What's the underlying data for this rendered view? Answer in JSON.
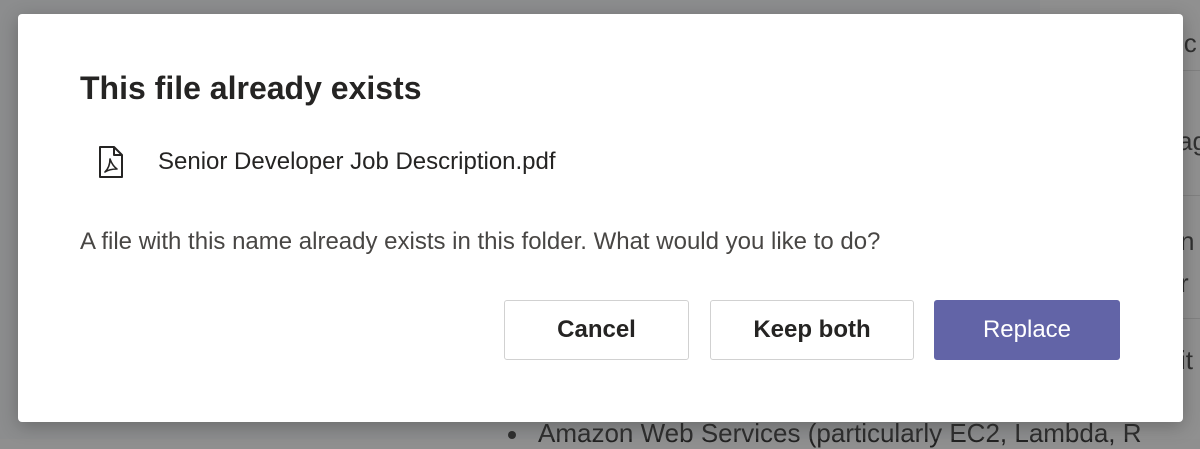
{
  "dialog": {
    "title": "This file already exists",
    "file_name": "Senior Developer Job Description.pdf",
    "file_icon": "pdf-file-icon",
    "message": "A file with this name already exists in this folder. What would you like to do?",
    "buttons": {
      "cancel": "Cancel",
      "keep_both": "Keep both",
      "replace": "Replace"
    }
  },
  "background": {
    "right_panel_fragments": [
      "ic",
      "ag",
      "n",
      "r",
      "it"
    ],
    "bottom_text": "Amazon Web Services (particularly EC2, Lambda, R"
  },
  "colors": {
    "primary": "#6264a7",
    "text": "#252423"
  }
}
